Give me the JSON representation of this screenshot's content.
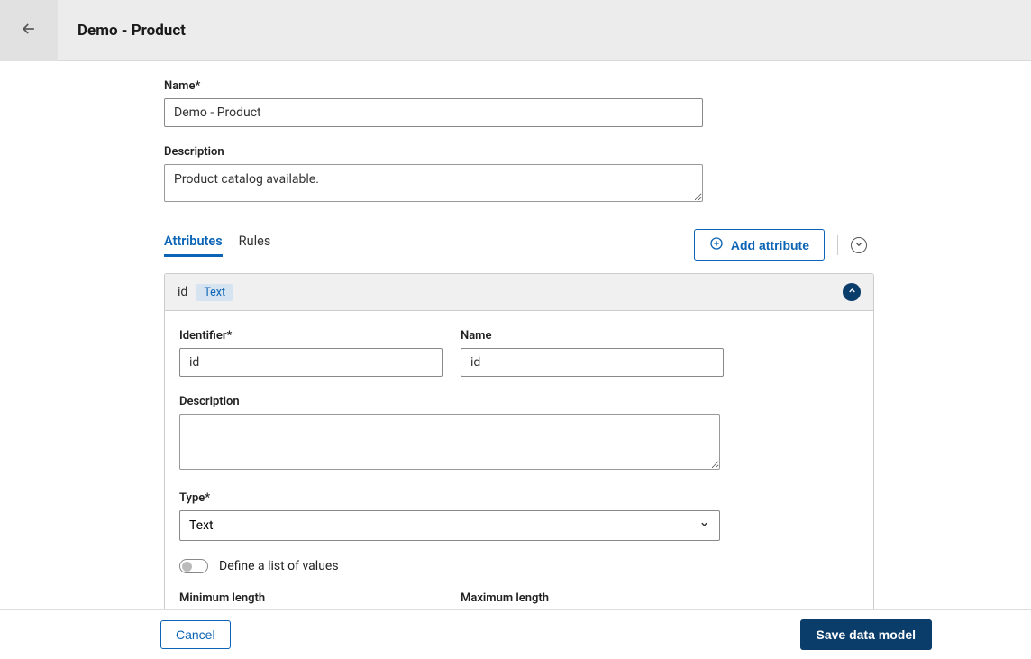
{
  "header": {
    "title": "Demo - Product"
  },
  "form": {
    "name_label": "Name*",
    "name_value": "Demo - Product",
    "description_label": "Description",
    "description_value": "Product catalog available."
  },
  "tabs": {
    "attributes_label": "Attributes",
    "rules_label": "Rules",
    "add_attribute_label": "Add attribute"
  },
  "attribute": {
    "header_id": "id",
    "header_type_badge": "Text",
    "identifier_label": "Identifier*",
    "identifier_value": "id",
    "name_label": "Name",
    "name_value": "id",
    "description_label": "Description",
    "description_value": "",
    "type_label": "Type*",
    "type_value": "Text",
    "list_values_label": "Define a list of values",
    "min_length_label": "Minimum length",
    "max_length_label": "Maximum length"
  },
  "footer": {
    "cancel_label": "Cancel",
    "save_label": "Save data model"
  }
}
